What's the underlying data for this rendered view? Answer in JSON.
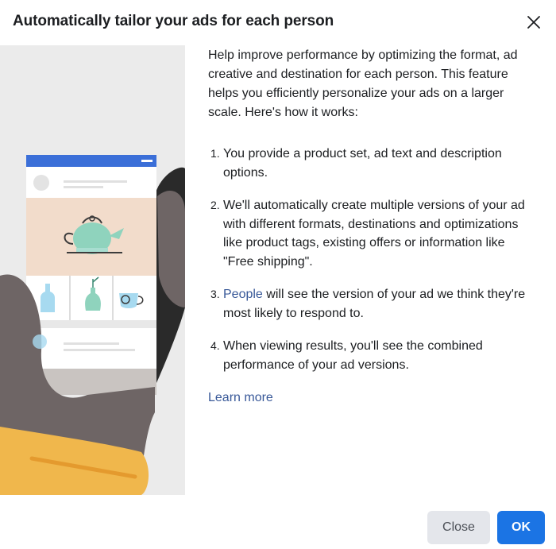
{
  "dialog": {
    "title": "Automatically tailor your ads for each person",
    "close_icon": "close-icon"
  },
  "content": {
    "intro": "Help improve performance by optimizing the format, ad creative and destination for each person. This feature helps you efficiently personalize your ads on a larger scale. Here's how it works:",
    "steps": [
      {
        "num": "1.",
        "text": "You provide a product set, ad text and description options."
      },
      {
        "num": "2.",
        "text": "We'll automatically create multiple versions of your ad with different formats, destinations and optimizations like product tags, existing offers or information like \"Free shipping\"."
      },
      {
        "num": "3.",
        "link": "People",
        "text": " will see the version of your ad we think they're most likely to respond to."
      },
      {
        "num": "4.",
        "text": "When viewing results, you'll see the combined performance of your ad versions."
      }
    ],
    "learn_more": "Learn more"
  },
  "footer": {
    "close_label": "Close",
    "ok_label": "OK"
  },
  "colors": {
    "link": "#385898",
    "primary_button": "#1b74e4",
    "secondary_button": "#e4e6eb",
    "illustration_bg": "#ebebeb",
    "phone_header": "#3b6fd8",
    "product_image_bg": "#f2dccb",
    "teapot": "#8fd3bd",
    "hand": "#6e6565",
    "sleeve": "#f0b74c"
  }
}
